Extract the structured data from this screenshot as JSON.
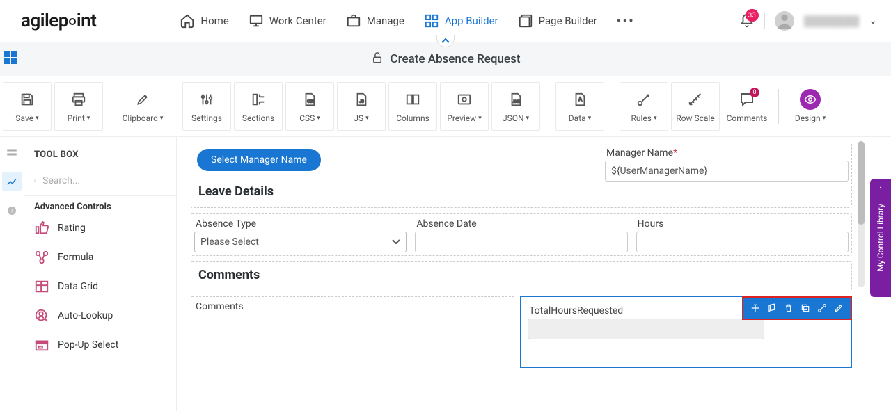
{
  "brand": "agilepoint",
  "nav": {
    "home": "Home",
    "work_center": "Work Center",
    "manage": "Manage",
    "app_builder": "App Builder",
    "page_builder": "Page Builder"
  },
  "notifications": "33",
  "subheader": {
    "title": "Create Absence Request"
  },
  "toolbar": {
    "save": "Save",
    "print": "Print",
    "clipboard": "Clipboard",
    "settings": "Settings",
    "sections": "Sections",
    "css": "CSS",
    "js": "JS",
    "columns": "Columns",
    "preview": "Preview",
    "json": "JSON",
    "data": "Data",
    "rules": "Rules",
    "row_scale": "Row Scale",
    "comments": "Comments",
    "comments_badge": "0",
    "design": "Design"
  },
  "sidebar": {
    "title": "TOOL BOX",
    "search_placeholder": "Search...",
    "group": "Advanced Controls",
    "items": [
      "Rating",
      "Formula",
      "Data Grid",
      "Auto-Lookup",
      "Pop-Up Select"
    ]
  },
  "form": {
    "select_manager_btn": "Select Manager Name",
    "manager_name_label": "Manager Name",
    "manager_name_value": "${UserManagerName}",
    "leave_details": "Leave Details",
    "absence_type_label": "Absence Type",
    "absence_type_placeholder": "Please Select",
    "absence_date_label": "Absence Date",
    "hours_label": "Hours",
    "comments_section": "Comments",
    "comments_label": "Comments",
    "total_hours_label": "TotalHoursRequested"
  },
  "right_panel": "My Control Library"
}
